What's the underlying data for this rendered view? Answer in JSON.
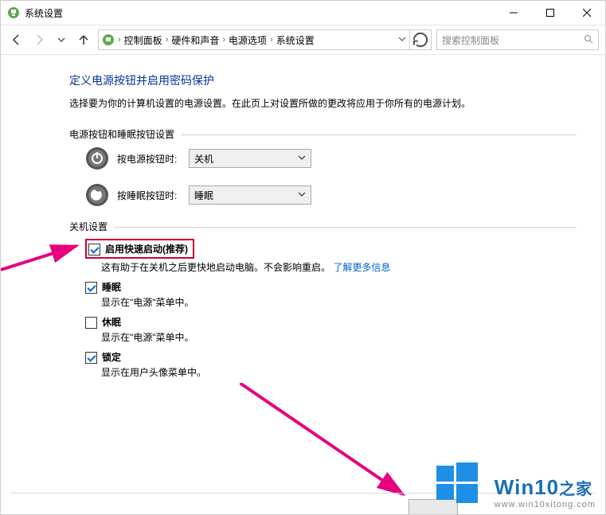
{
  "window": {
    "title": "系统设置"
  },
  "breadcrumb": {
    "items": [
      "控制面板",
      "硬件和声音",
      "电源选项",
      "系统设置"
    ]
  },
  "search": {
    "placeholder": "搜索控制面板"
  },
  "heading": "定义电源按钮并启用密码保护",
  "description": "选择要为你的计算机设置的电源设置。在此页上对设置所做的更改将应用于你所有的电源计划。",
  "section1": {
    "title": "电源按钮和睡眠按钮设置",
    "rows": [
      {
        "label": "按电源按钮时:",
        "value": "关机"
      },
      {
        "label": "按睡眠按钮时:",
        "value": "睡眠"
      }
    ]
  },
  "section2": {
    "title": "关机设置",
    "items": [
      {
        "checked": true,
        "highlighted": true,
        "label": "启用快速启动(推荐)",
        "desc_prefix": "这有助于在关机之后更快地启动电脑。不会影响重启。",
        "link": "了解更多信息"
      },
      {
        "checked": true,
        "label": "睡眠",
        "desc": "显示在\"电源\"菜单中。"
      },
      {
        "checked": false,
        "label": "休眠",
        "desc": "显示在\"电源\"菜单中。"
      },
      {
        "checked": true,
        "label": "锁定",
        "desc": "显示在用户头像菜单中。"
      }
    ]
  },
  "watermark": {
    "brand": "Win10",
    "suffix": "之家",
    "url": "www.win10xitong.com"
  }
}
